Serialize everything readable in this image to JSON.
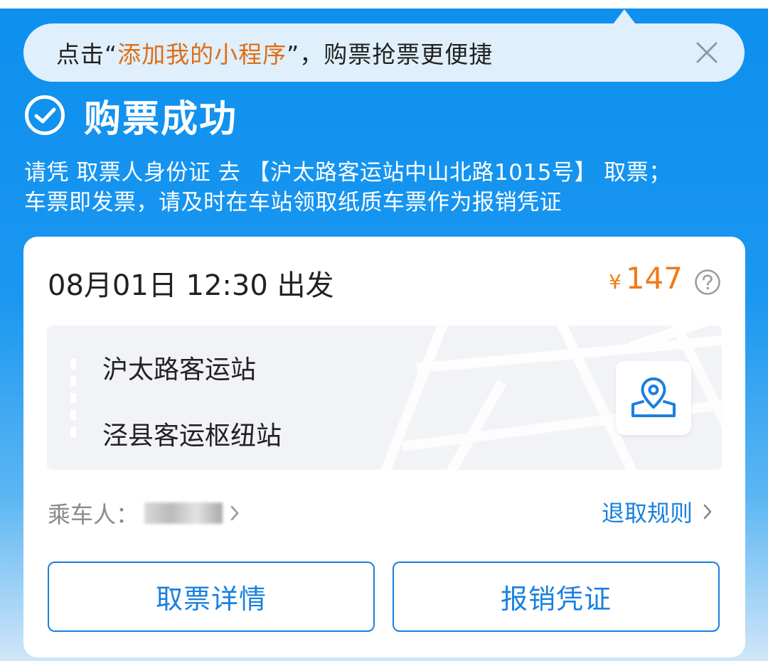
{
  "banner": {
    "prefix": "点击“",
    "highlight": "添加我的小程序",
    "suffix": "”，购票抢票更便捷",
    "highlight_color": "#e06d14"
  },
  "status": {
    "title": "购票成功",
    "notice_line1": "请凭 取票人身份证 去 【沪太路客运站中山北路1015号】 取票；",
    "notice_line2": "车票即发票，请及时在车站领取纸质车票作为报销凭证"
  },
  "ticket": {
    "departure": "08月01日 12:30 出发",
    "currency": "¥",
    "price": "147",
    "from_station": "沪太路客运站",
    "to_station": "泾县客运枢纽站",
    "passenger_label": "乘车人：",
    "refund_rules": "退取规则"
  },
  "actions": {
    "pickup_details": "取票详情",
    "reimbursement": "报销凭证"
  },
  "icons": {
    "close": "close-icon",
    "success": "check-circle-icon",
    "help": "question-circle-icon",
    "map": "map-pin-icon",
    "chevron": "chevron-right-icon"
  },
  "colors": {
    "primary_blue": "#1a80de",
    "header_blue": "#0d8fee",
    "price_orange": "#f07b14"
  }
}
